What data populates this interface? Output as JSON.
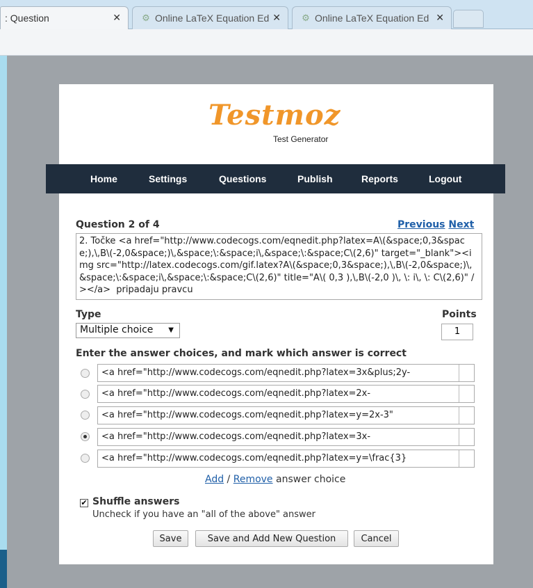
{
  "browser": {
    "tabs": [
      {
        "label": ": Question",
        "active": true
      },
      {
        "label": "Online LaTeX Equation Ed",
        "active": false
      },
      {
        "label": "Online LaTeX Equation Ed",
        "active": false
      }
    ],
    "tab_close_glyph": "✕"
  },
  "logo": {
    "title": "Testmoz",
    "subtitle": "Test Generator",
    "color": "#f0962a"
  },
  "nav": {
    "items": [
      "Home",
      "Settings",
      "Questions",
      "Publish",
      "Reports",
      "Logout"
    ]
  },
  "question": {
    "heading": "Question 2 of 4",
    "previous": "Previous",
    "next": "Next",
    "text": "2. Točke <a href=\"http://www.codecogs.com/eqnedit.php?latex=A\\(&space;0,3&space;),\\,B\\(-2,0&space;)\\,&space;\\:&space;i\\,&space;\\:&space;C\\(2,6)\" target=\"_blank\"><img src=\"http://latex.codecogs.com/gif.latex?A\\(&space;0,3&space;),\\,B\\(-2,0&space;)\\,&space;\\:&space;i\\,&space;\\:&space;C\\(2,6)\" title=\"A\\( 0,3 ),\\,B\\(-2,0 )\\, \\: i\\, \\: C\\(2,6)\" /></a>  pripadaju pravcu"
  },
  "type": {
    "label": "Type",
    "selected": "Multiple choice"
  },
  "points": {
    "label": "Points",
    "value": "1"
  },
  "answers": {
    "label": "Enter the answer choices, and mark which answer is correct",
    "choices": [
      {
        "text": "<a href=\"http://www.codecogs.com/eqnedit.php?latex=3x&plus;2y-",
        "correct": false
      },
      {
        "text": "<a href=\"http://www.codecogs.com/eqnedit.php?latex=2x-",
        "correct": false
      },
      {
        "text": "<a href=\"http://www.codecogs.com/eqnedit.php?latex=y=2x-3\"",
        "correct": false
      },
      {
        "text": "<a href=\"http://www.codecogs.com/eqnedit.php?latex=3x-",
        "correct": true
      },
      {
        "text": "<a href=\"http://www.codecogs.com/eqnedit.php?latex=y=\\frac{3}",
        "correct": false
      }
    ],
    "add_label": "Add",
    "separator": " / ",
    "remove_label": "Remove",
    "suffix": " answer choice"
  },
  "shuffle": {
    "label": "Shuffle answers",
    "hint": "Uncheck if you have an \"all of the above\" answer",
    "checked": true
  },
  "buttons": {
    "save": "Save",
    "save_add": "Save and Add New Question",
    "cancel": "Cancel"
  }
}
